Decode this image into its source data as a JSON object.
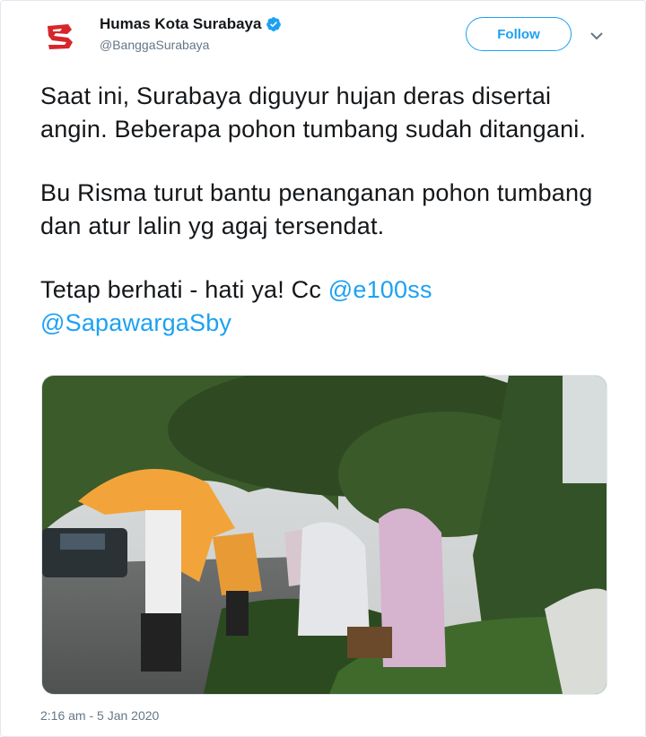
{
  "account": {
    "display_name": "Humas Kota Surabaya",
    "handle": "@BanggaSurabaya",
    "verified": true,
    "avatar_icon": "surabaya-logo-icon"
  },
  "follow_button": {
    "label": "Follow"
  },
  "more_icon": "chevron-down-icon",
  "tweet": {
    "paragraph1": "Saat ini, Surabaya diguyur hujan deras disertai angin. Beberapa pohon tumbang sudah ditangani.",
    "paragraph2": "Bu Risma turut bantu penanganan pohon tumbang dan atur lalin yg agaj tersendat.",
    "paragraph3_text": "Tetap berhati - hati ya! Cc ",
    "mention1": "@e100ss",
    "mention2": "@SapawargaSby"
  },
  "timestamp": "2:16 am - 5 Jan 2020",
  "colors": {
    "accent": "#1da1f2",
    "text": "#14171a",
    "muted": "#657786",
    "brand_red": "#d7262b"
  }
}
